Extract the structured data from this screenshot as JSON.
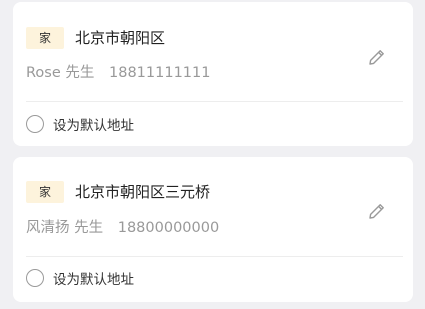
{
  "addresses": [
    {
      "tag": "家",
      "address": "北京市朝阳区",
      "name": "Rose",
      "title": "先生",
      "phone": "18811111111",
      "default_label": "设为默认地址",
      "is_default": false
    },
    {
      "tag": "家",
      "address": "北京市朝阳区三元桥",
      "name": "风清扬",
      "title": "先生",
      "phone": "18800000000",
      "default_label": "设为默认地址",
      "is_default": false
    }
  ],
  "icons": {
    "edit": "pencil-icon",
    "radio": "radio-unchecked"
  }
}
